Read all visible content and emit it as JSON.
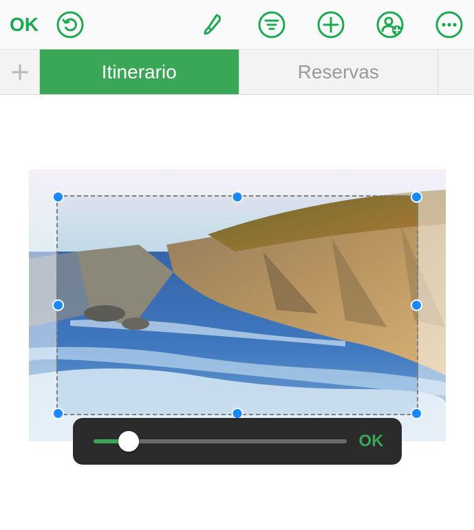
{
  "toolbar": {
    "ok_label": "OK",
    "icons": {
      "undo": "undo-icon",
      "brush": "brush-icon",
      "filter": "filter-icon",
      "add": "plus-icon",
      "share": "add-person-icon",
      "more": "more-icon"
    }
  },
  "tabs": {
    "add_icon": "plus-icon",
    "items": [
      {
        "label": "Itinerario",
        "active": true
      },
      {
        "label": "Reservas",
        "active": false
      }
    ]
  },
  "mask_bar": {
    "slider_value": 14,
    "ok_label": "OK"
  },
  "colors": {
    "accent": "#3aa757",
    "handle": "#1989ff"
  }
}
